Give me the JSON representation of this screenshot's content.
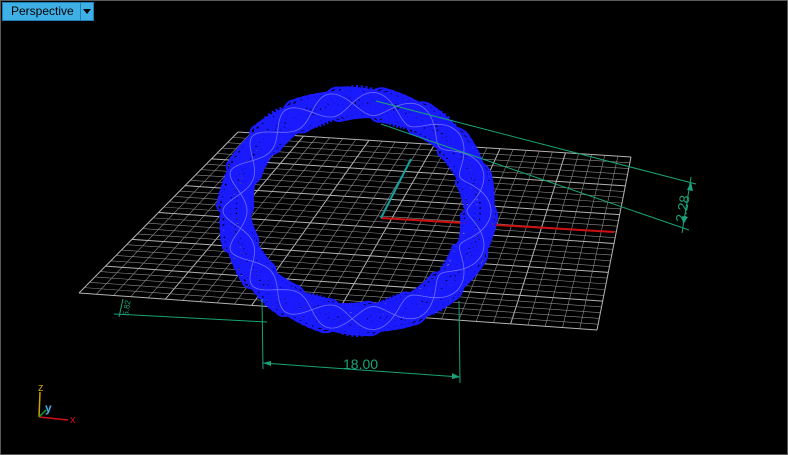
{
  "viewport": {
    "title": "Perspective",
    "menu_icon": "dropdown-arrow-icon"
  },
  "dimensions": {
    "width_value": "18.00",
    "height_value": "2.28",
    "small_value": "5.82"
  },
  "axes": {
    "x_label": "x",
    "y_label": "y",
    "z_label": "z"
  },
  "colors": {
    "background": "#000000",
    "grid": "#8c8c8c",
    "grid_major": "#b4b4b4",
    "ring": "#1a1aff",
    "dimension": "#1aa37a",
    "x_axis": "#d01010",
    "y_axis": "#10a0a0",
    "tab": "#3fb0e6"
  }
}
